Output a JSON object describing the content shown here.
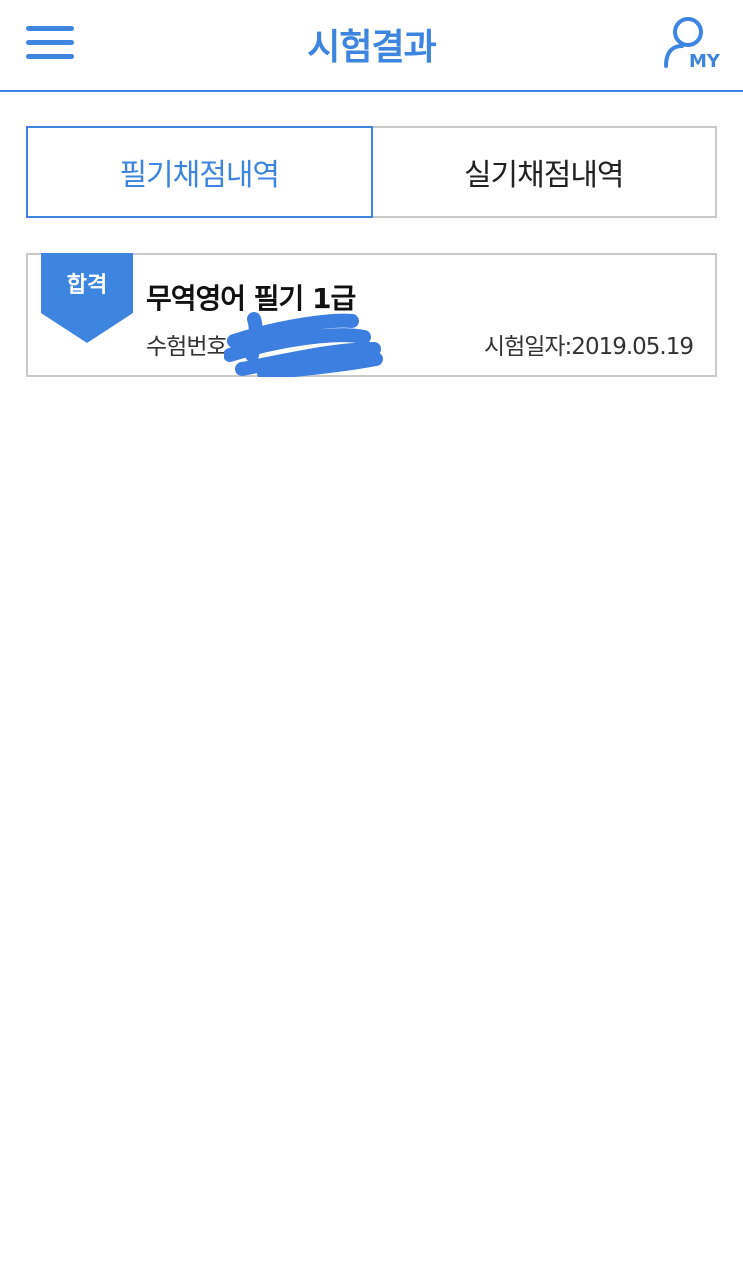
{
  "header": {
    "title": "시험결과",
    "menu_icon": "hamburger-menu-icon",
    "my_icon": "user-my-icon",
    "my_label": "MY"
  },
  "tabs": [
    {
      "label": "필기채점내역",
      "active": true
    },
    {
      "label": "실기채점내역",
      "active": false
    }
  ],
  "results": [
    {
      "badge": "합격",
      "title": "무역영어 필기 1급",
      "number_label": "수험번호:",
      "date_label": "시험일자:2019.05.19"
    }
  ],
  "colors": {
    "accent": "#3d85de",
    "border": "#c9c9c9",
    "badge": "#3d85de"
  }
}
